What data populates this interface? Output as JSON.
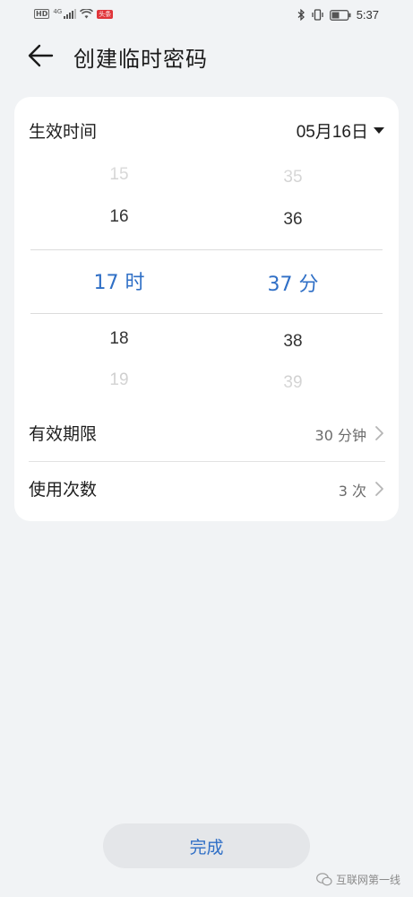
{
  "status_bar": {
    "hd": "HD",
    "network": "4G",
    "app_badge": "头条",
    "time": "5:37"
  },
  "header": {
    "title": "创建临时密码"
  },
  "effective_time": {
    "label": "生效时间",
    "date": "05月16日"
  },
  "picker": {
    "hours": [
      "15",
      "16",
      "17 时",
      "18",
      "19"
    ],
    "minutes": [
      "35",
      "36",
      "37 分",
      "38",
      "39"
    ]
  },
  "validity": {
    "label": "有效期限",
    "value": "30 分钟"
  },
  "usage_count": {
    "label": "使用次数",
    "value": "3 次"
  },
  "done_button": {
    "label": "完成"
  },
  "watermark": {
    "text": "互联网第一线"
  },
  "colors": {
    "accent": "#2f6fc6",
    "background": "#f1f3f5",
    "card": "#ffffff"
  }
}
